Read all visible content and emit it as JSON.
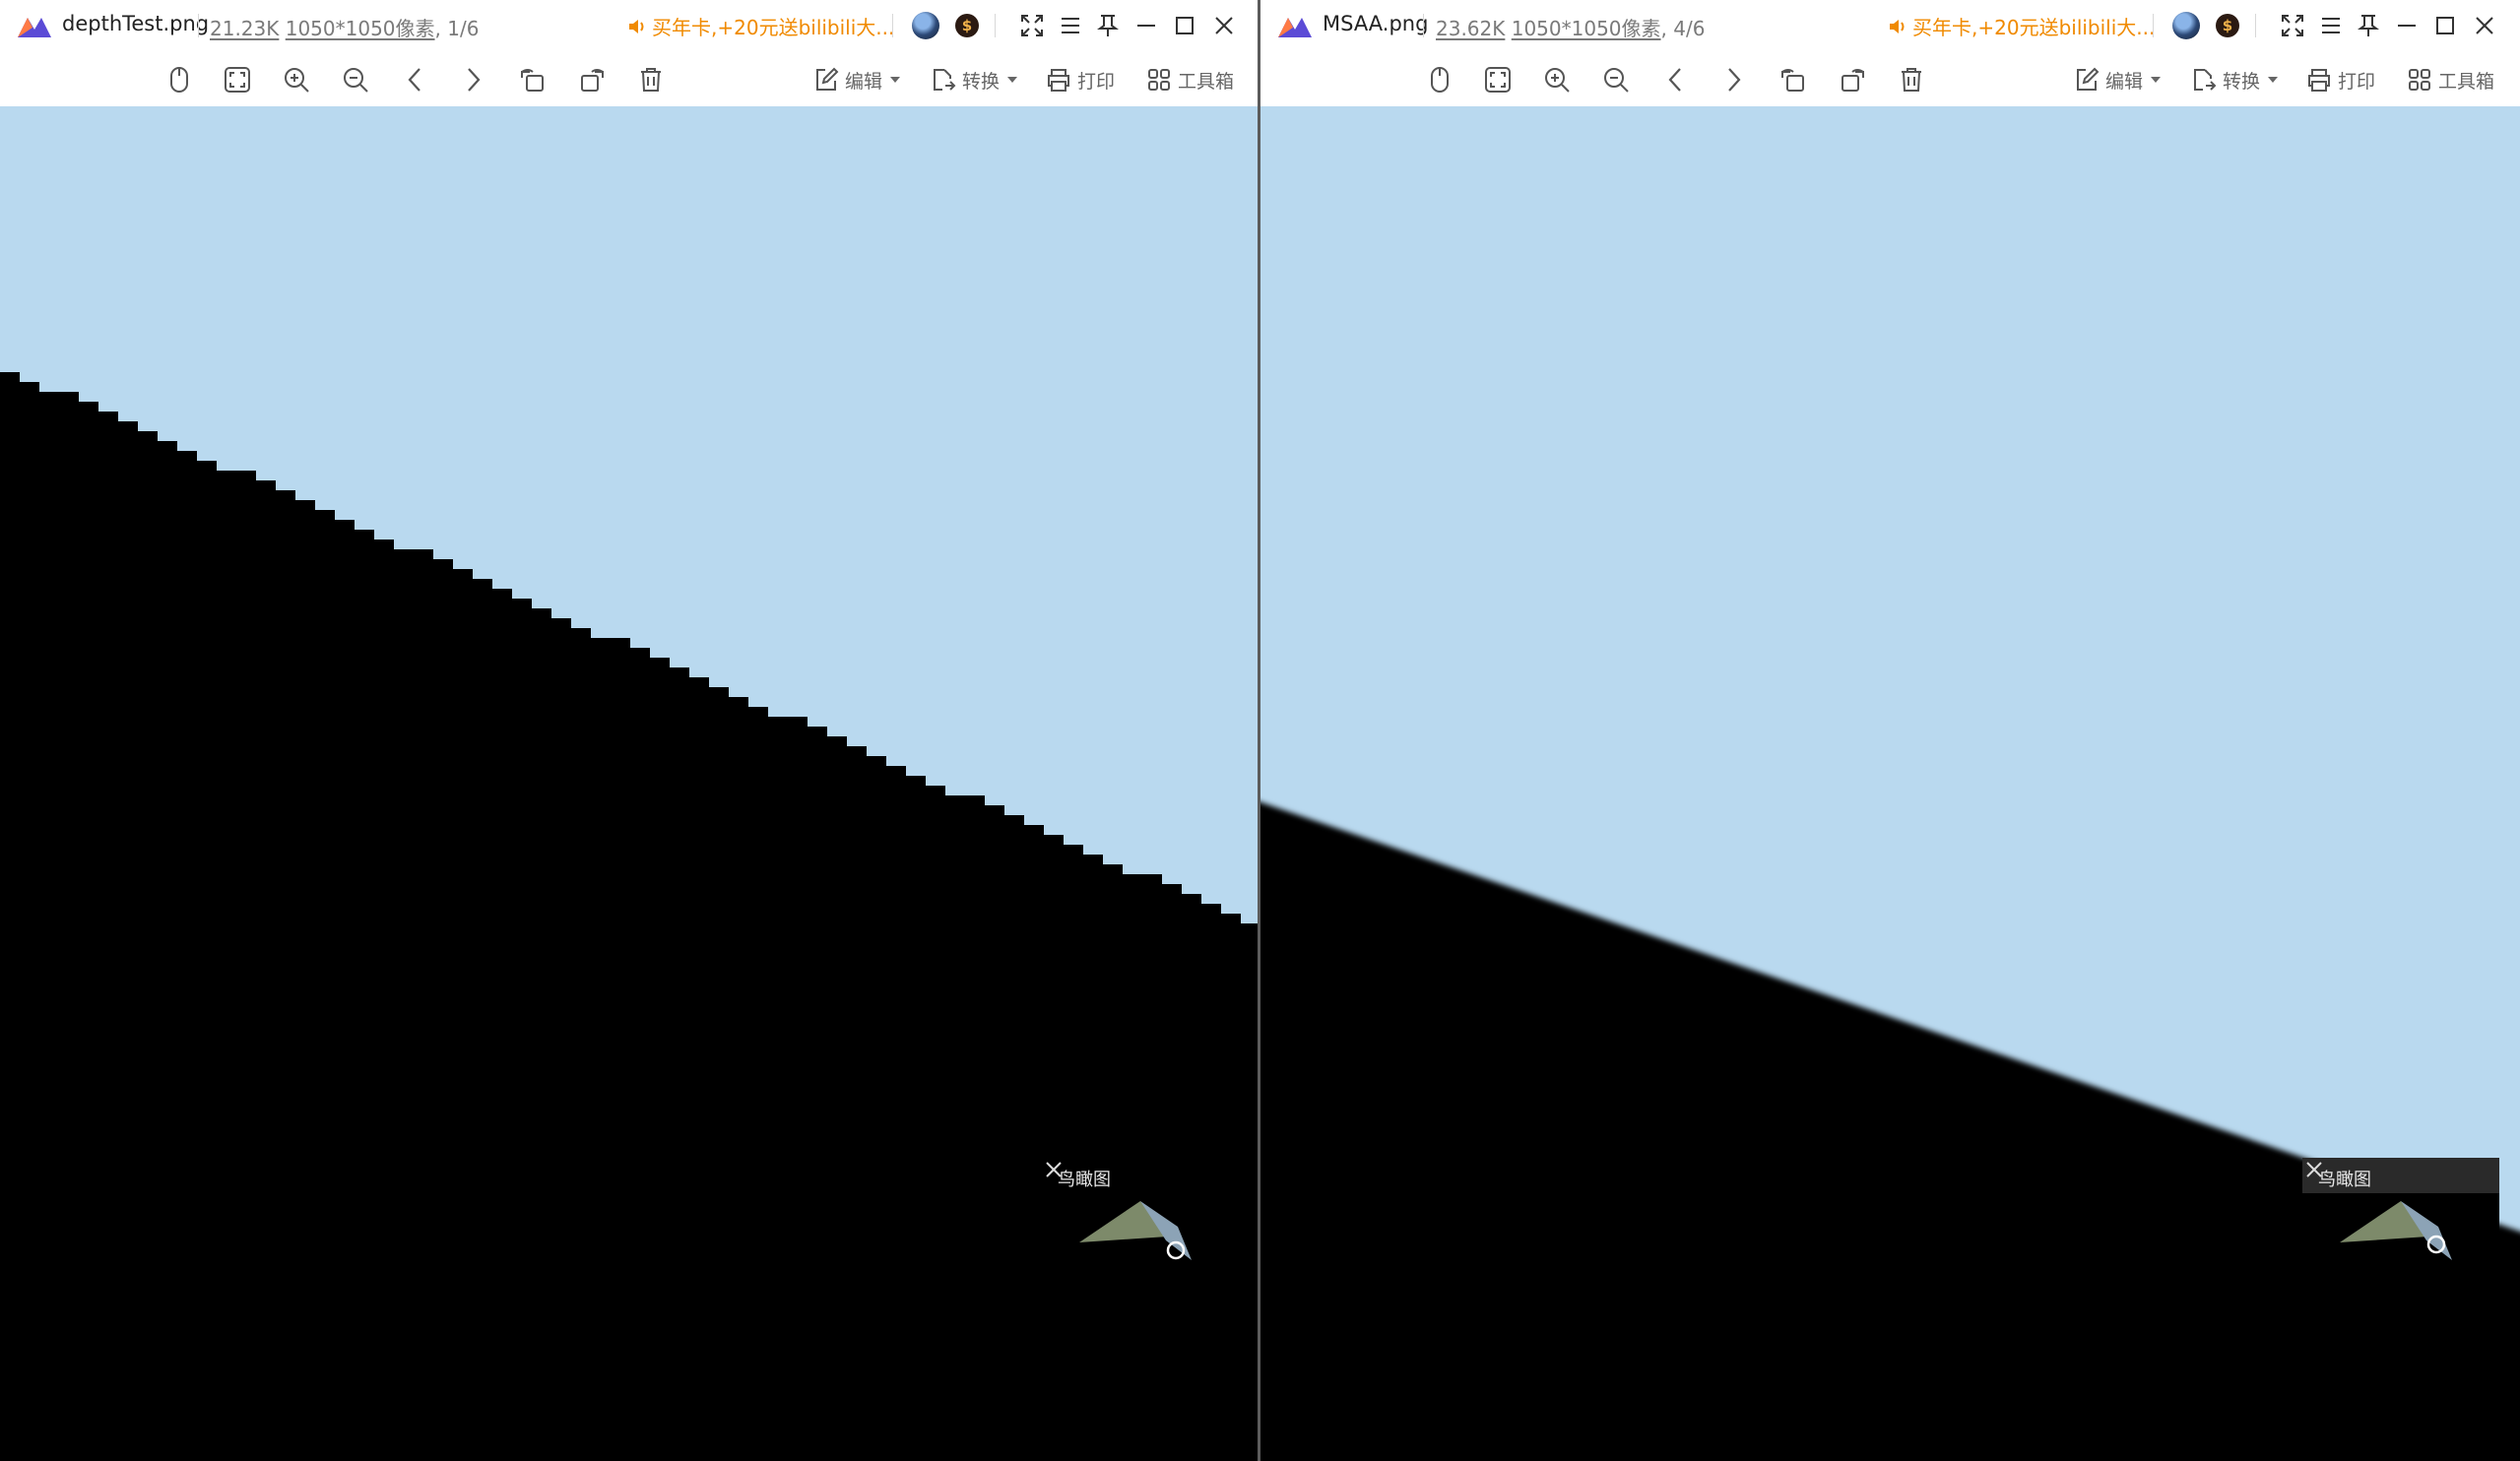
{
  "colors": {
    "sky": "#b9d9ef",
    "ground": "#000000",
    "promo": "#f08a00",
    "thumb_triangle": "#7d8a6a",
    "thumb_shadow": "#8ca3b6"
  },
  "windows": [
    {
      "file_name": "depthTest.png",
      "file_size": "21.23K",
      "dimensions": "1050*1050像素",
      "page_index": ", 1/6",
      "promo_text": "买年卡,+20元送bilibili大...",
      "toolbar": {
        "edit": "编辑",
        "convert": "转换",
        "print": "打印",
        "toolbox": "工具箱"
      },
      "birdview": {
        "title": "鸟瞰图"
      }
    },
    {
      "file_name": "MSAA.png",
      "file_size": "23.62K",
      "dimensions": "1050*1050像素",
      "page_index": ", 4/6",
      "promo_text": "买年卡,+20元送bilibili大...",
      "toolbar": {
        "edit": "编辑",
        "convert": "转换",
        "print": "打印",
        "toolbox": "工具箱"
      },
      "birdview": {
        "title": "鸟瞰图"
      }
    }
  ],
  "icons": {
    "app": "image-viewer-logo-icon",
    "speaker": "speaker-icon",
    "fullscreen": "fullscreen-icon",
    "menu": "menu-icon",
    "pin": "pin-icon",
    "minimize": "minimize-icon",
    "maximize": "maximize-icon",
    "close": "close-icon"
  }
}
